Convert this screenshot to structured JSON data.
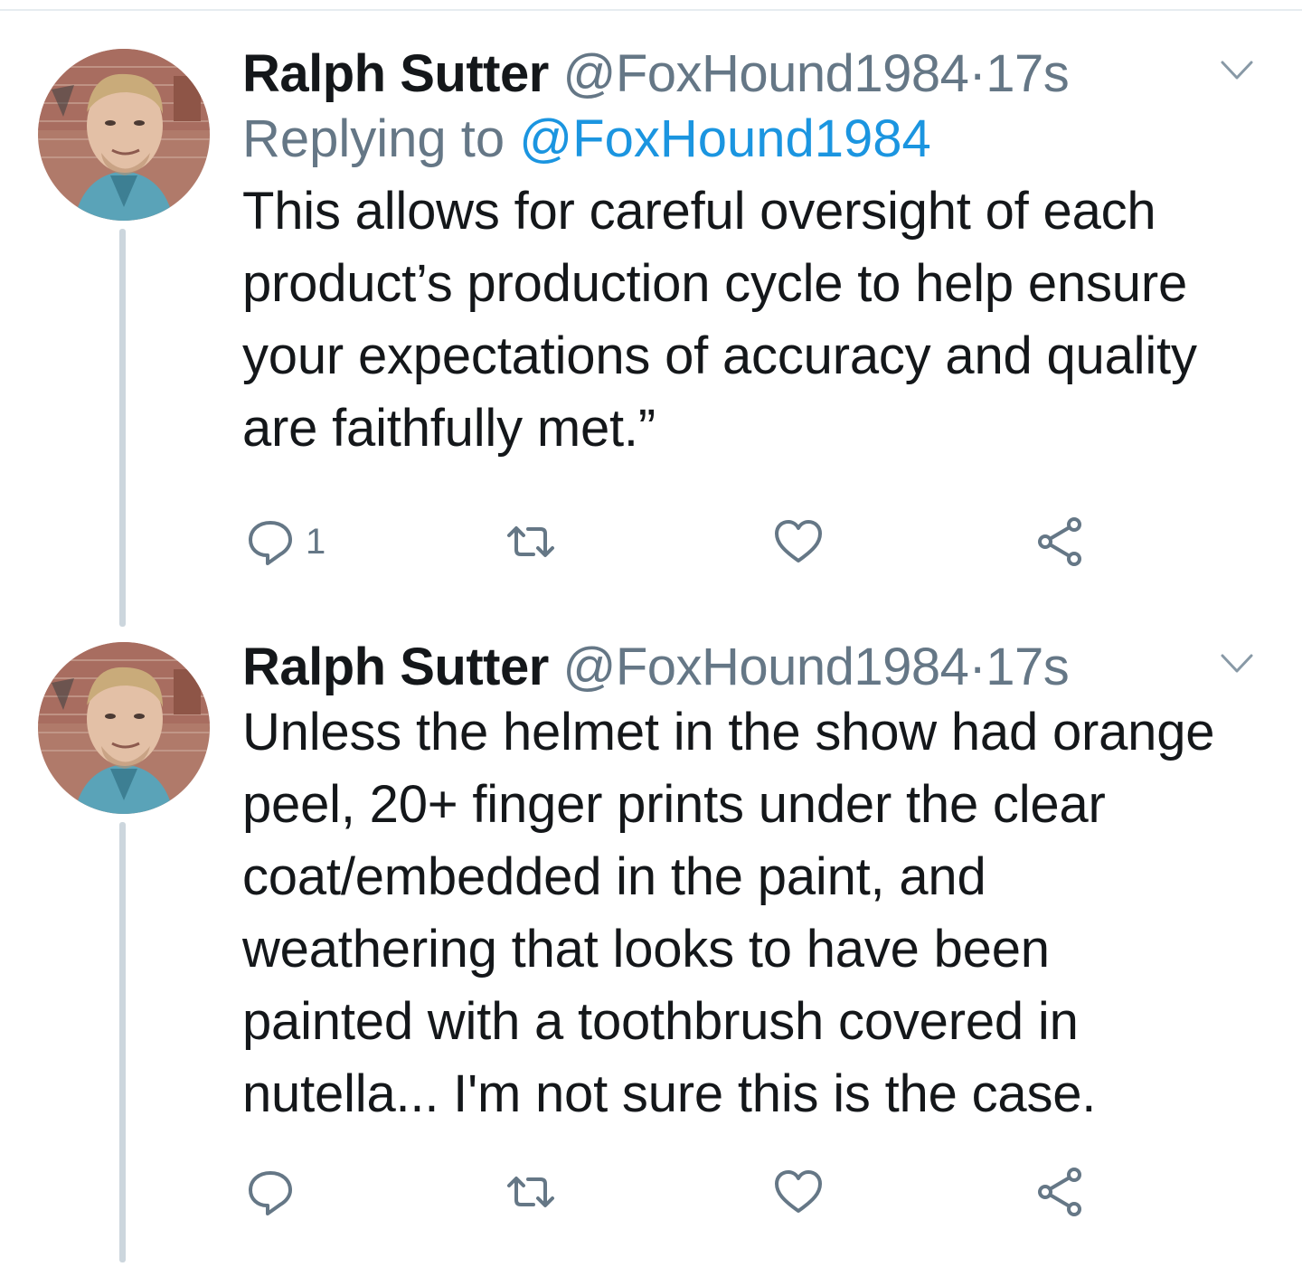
{
  "colors": {
    "text": "#14171a",
    "secondary": "#657786",
    "link": "#1b95e0",
    "thread": "#ccd6dd"
  },
  "tweets": [
    {
      "name": "Ralph Sutter",
      "handle": "@FoxHound1984",
      "separator": "·",
      "time": "17s",
      "replying_prefix": "Replying to ",
      "replying_to": "@FoxHound1984",
      "text": "This allows for careful oversight of each\nproduct’s production cycle to help ensure\nyour expectations of accuracy and quality\nare faithfully met.”",
      "reply_count": "1",
      "icons": [
        "reply-icon",
        "retweet-icon",
        "like-icon",
        "share-icon",
        "chevron-down-icon"
      ]
    },
    {
      "name": "Ralph Sutter",
      "handle": "@FoxHound1984",
      "separator": "·",
      "time": "17s",
      "text": "Unless the helmet in the show had orange\npeel, 20+ finger prints under the clear\ncoat/embedded in the paint, and\nweathering that looks to have been\npainted with a toothbrush covered in\nnutella... I'm not sure this is the case.",
      "reply_count": "",
      "icons": [
        "reply-icon",
        "retweet-icon",
        "like-icon",
        "share-icon",
        "chevron-down-icon"
      ]
    }
  ]
}
